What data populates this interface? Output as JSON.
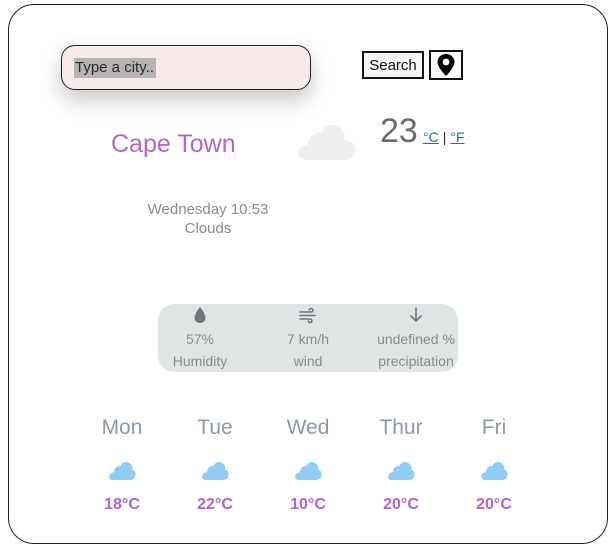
{
  "search": {
    "placeholder": "Type a city..",
    "button_label": "Search",
    "location_icon": "map-pin-icon"
  },
  "current": {
    "city": "Cape Town",
    "icon": "cloud-icon",
    "temperature": "23",
    "unit_celsius": "°C",
    "unit_separator": "|",
    "unit_fahrenheit": "°F",
    "day_time": "Wednesday 10:53",
    "condition": "Clouds"
  },
  "stats": {
    "humidity": {
      "icon": "droplet-icon",
      "value": "57%",
      "label": "Humidity"
    },
    "wind": {
      "icon": "wind-icon",
      "value": "7 km/h",
      "label": "wind"
    },
    "precipitation": {
      "icon": "arrow-down-icon",
      "value": "undefined %",
      "label": "precipitation"
    }
  },
  "forecast": [
    {
      "day": "Mon",
      "icon": "cloud-icon",
      "temp": "18°C"
    },
    {
      "day": "Tue",
      "icon": "cloud-icon",
      "temp": "22°C"
    },
    {
      "day": "Wed",
      "icon": "cloud-icon",
      "temp": "10°C"
    },
    {
      "day": "Thur",
      "icon": "cloud-icon",
      "temp": "20°C"
    },
    {
      "day": "Fri",
      "icon": "cloud-icon",
      "temp": "20°C"
    }
  ],
  "colors": {
    "accent": "#b566c9",
    "forecast_temp": "#b062d6",
    "forecast_cloud": "#8fcdf5",
    "stats_background": "#dfe5e4"
  }
}
